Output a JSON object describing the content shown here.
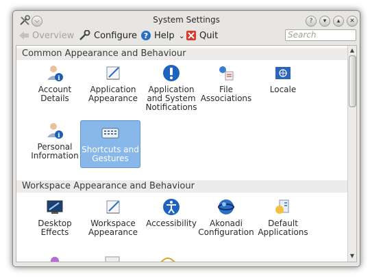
{
  "window": {
    "title": "System Settings"
  },
  "titlebar": {
    "app_icon": "tools-icon",
    "buttons": [
      "?",
      "▾",
      "▴",
      "✕"
    ]
  },
  "toolbar": {
    "overview": "Overview",
    "configure": "Configure",
    "help": "Help",
    "help_arrow": "⌄",
    "quit": "Quit",
    "search_placeholder": "Search"
  },
  "sections": [
    {
      "title": "Common Appearance and Behaviour",
      "items": [
        {
          "label": "Account Details",
          "icon": "user-info-icon"
        },
        {
          "label": "Application Appearance",
          "icon": "paint-easel-icon"
        },
        {
          "label": "Application and System Notifications",
          "icon": "exclamation-icon"
        },
        {
          "label": "File Associations",
          "icon": "file-associations-icon"
        },
        {
          "label": "Locale",
          "icon": "flag-icon"
        },
        {
          "label": "Personal Information",
          "icon": "user-info-icon"
        },
        {
          "label": "Shortcuts and Gestures",
          "icon": "keyboard-icon",
          "selected": true
        }
      ]
    },
    {
      "title": "Workspace Appearance and Behaviour",
      "items": [
        {
          "label": "Desktop Effects",
          "icon": "desktop-effects-icon"
        },
        {
          "label": "Workspace Appearance",
          "icon": "paint-easel-icon"
        },
        {
          "label": "Accessibility",
          "icon": "accessibility-icon"
        },
        {
          "label": "Akonadi Configuration",
          "icon": "akonadi-icon"
        },
        {
          "label": "Default Applications",
          "icon": "default-apps-icon"
        }
      ]
    }
  ],
  "colors": {
    "selection": "#88b7ea",
    "accent": "#1e5fb5",
    "quit_red": "#d93a2b"
  }
}
